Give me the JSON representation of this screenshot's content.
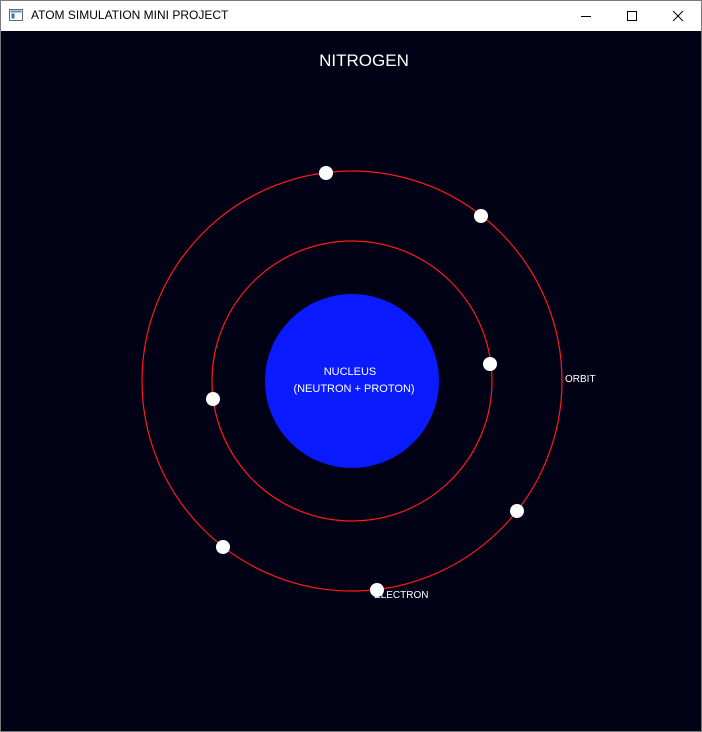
{
  "window": {
    "title": "ATOM SIMULATION MINI PROJECT",
    "controls": {
      "minimize_icon": "minimize-icon",
      "maximize_icon": "maximize-icon",
      "close_icon": "close-icon"
    }
  },
  "simulation": {
    "element_name": "NITROGEN",
    "nucleus_label": "NUCLEUS",
    "nucleus_composition": "(NEUTRON + PROTON)",
    "orbit_label": "ORBIT",
    "electron_label": "ELECTRON",
    "electron_count": 7,
    "shells": [
      {
        "electrons": 2
      },
      {
        "electrons": 5
      }
    ]
  },
  "colors": {
    "background": "#020217",
    "nucleus": "#0a1bff",
    "orbit": "#ff1a1a",
    "electron": "#ffffff",
    "text": "#ffffff"
  }
}
